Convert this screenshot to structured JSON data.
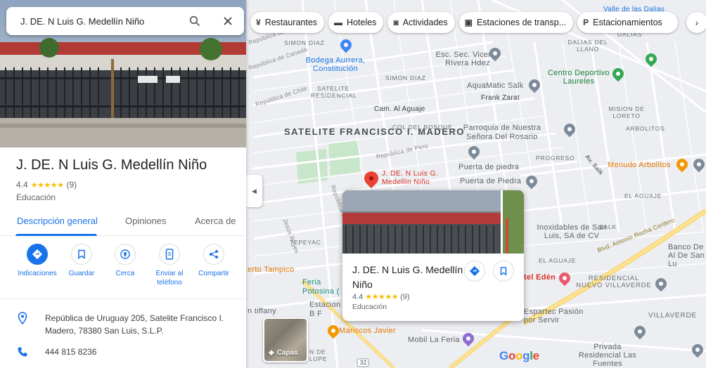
{
  "search": {
    "value": "J. DE. N Luis G. Medellín Niño"
  },
  "place": {
    "title": "J. DE. N Luis G. Medellín Niño",
    "rating": "4.4",
    "stars": "★★★★★",
    "reviews": "(9)",
    "category": "Educación"
  },
  "tabs": [
    {
      "label": "Descripción general"
    },
    {
      "label": "Opiniones"
    },
    {
      "label": "Acerca de"
    }
  ],
  "actions": [
    {
      "label": "Indicaciones",
      "icon": "directions-icon"
    },
    {
      "label": "Guardar",
      "icon": "bookmark-icon"
    },
    {
      "label": "Cerca",
      "icon": "nearby-icon"
    },
    {
      "label": "Enviar al teléfono",
      "icon": "send-to-phone-icon"
    },
    {
      "label": "Compartir",
      "icon": "share-icon"
    }
  ],
  "info": {
    "address": "República de Uruguay 205, Satelite Francisco I. Madero, 78380 San Luis, S.L.P.",
    "phone": "444 815 8236"
  },
  "chips": [
    {
      "label": "Restaurantes",
      "icon": "restaurant-icon"
    },
    {
      "label": "Hoteles",
      "icon": "hotel-icon"
    },
    {
      "label": "Actividades",
      "icon": "activities-icon"
    },
    {
      "label": "Estaciones de transp...",
      "icon": "transit-icon"
    },
    {
      "label": "Estacionamientos",
      "icon": "parking-icon"
    }
  ],
  "card": {
    "title": "J. DE. N Luis G. Medellín Niño",
    "rating": "4.4",
    "stars": "★★★★★",
    "reviews": "(9)",
    "category": "Educación"
  },
  "layers_label": "Capas",
  "map_labels": {
    "satelite_fm": "SATELITE FRANCISCO I. MADERO",
    "simon_diaz_1": "SIMON DIAZ",
    "simon_diaz_2": "SIMON DIAZ",
    "satelite_res": "SATELITE RESIDENCIAL",
    "col_bosque": "COL DEL BOSQUE",
    "cam_aguaje": "Cam. Al Aguaje",
    "bodega": "Bodega Aurrera, Constitución",
    "esc_sec": "Esc. Sec. Vicente Rivera Hdez",
    "aquamatic": "AquaMatic Salk",
    "frank": "Frank Zarat",
    "centro_dep": "Centro Deportivo Laureles",
    "dalias": "DALIAS DEL LLANO",
    "dalias2": "DALIAS",
    "valle_dalias": "Valle de las Dalias",
    "mision": "MISION DE LORETO",
    "arbolitos": "ARBOLITOS",
    "parroquia": "Parroquia de Nuestra Señora Del Rosario",
    "progreso": "PROGRESO",
    "puerta_piedra_1": "Puerta de piedra",
    "puerta_piedra_2": "Puerta de Piedra",
    "menudo": "Menudo Arbolitos",
    "el_aguaje_1": "EL AGUAJE",
    "el_aguaje_2": "EL AGUAJE",
    "inoxidables": "Inoxidables de San Luis, SA de CV",
    "salk": "SALK",
    "banco": "Banco De Al De San Lu",
    "blvd": "Blvd. Antonio Rocha Cordero",
    "residencial": "RESIDENCIAL NUEVO VILLAVERDE",
    "villaverde": "VILLAVERDE",
    "edén": "tel Edén",
    "espartec": "Espartec Pasión por Servir",
    "mariscos": "Mariscos Javier",
    "mobil": "Mobil La Feria",
    "privada": "Privada Residencial Las Fuentes",
    "tepeyac": "TEPEYAC",
    "tampico": "erto Tampico",
    "feria": "Feria Potosina (",
    "estacion": "Estacion B F",
    "tiffany": "n tiffany",
    "guadalupe": "N DE LUPE",
    "pin_label": "J. DE. N Luis G. Medellín Niño",
    "av_salk": "Av. Salk",
    "rep_peru": "República de Perú",
    "rep_chile": "República de Chile",
    "rep_bolivia": "República de Bolivia",
    "rep_canada": "República de Canadá",
    "rep_uruguay": "República de Uruguay",
    "jesus": "Jesús Reyes",
    "highway": "32",
    "google": "Google"
  }
}
